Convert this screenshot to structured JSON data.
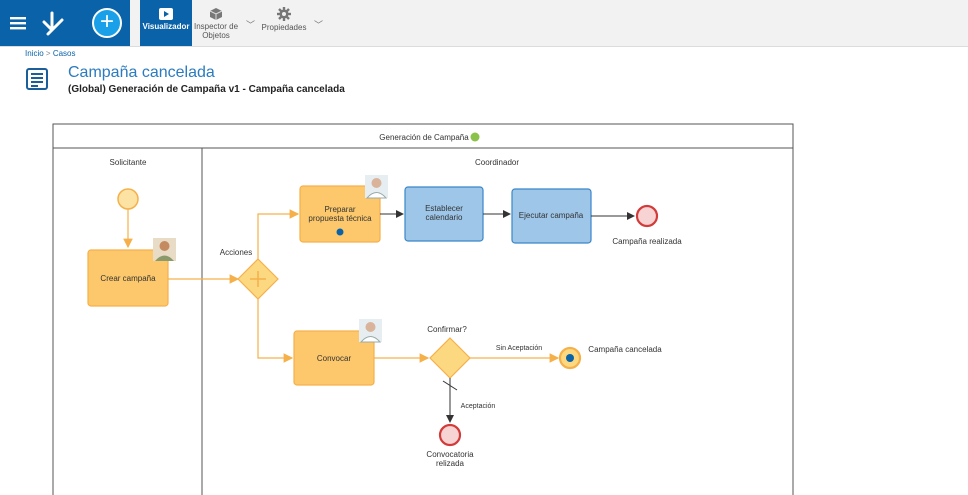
{
  "toolbar": {
    "visualizer_label": "Visualizador",
    "object_inspector_label_1": "Inspector de",
    "object_inspector_label_2": "Objetos",
    "properties_label": "Propiedades"
  },
  "breadcrumb": {
    "home": "Inicio",
    "separator": ">",
    "current": "Casos"
  },
  "header": {
    "title": "Campaña cancelada",
    "subtitle": "(Global) Generación de Campaña v1 - Campaña cancelada"
  },
  "diagram": {
    "pool_title": "Generación de Campaña",
    "lanes": [
      "Solicitante",
      "Coordinador"
    ],
    "tasks": {
      "crear_campana": "Crear campaña",
      "preparar_1": "Preparar",
      "preparar_2": "propuesta técnica",
      "establecer_1": "Establecer",
      "establecer_2": "calendario",
      "ejecutar": "Ejecutar campaña",
      "convocar": "Convocar"
    },
    "gateways": {
      "acciones": "Acciones",
      "confirmar": "Confirmar?"
    },
    "flows": {
      "sin_aceptacion": "Sin Aceptación",
      "aceptacion": "Aceptación"
    },
    "events": {
      "campana_realizada": "Campaña realizada",
      "campana_cancelada": "Campaña cancelada",
      "convocatoria_1": "Convocatoria",
      "convocatoria_2": "relizada"
    }
  },
  "colors": {
    "brand_blue": "#0a62a8",
    "task_orange": "#fcc86b",
    "task_blue": "#9dc6e9",
    "end_red": "#f3c4c4",
    "status_green": "#8bc34a"
  }
}
